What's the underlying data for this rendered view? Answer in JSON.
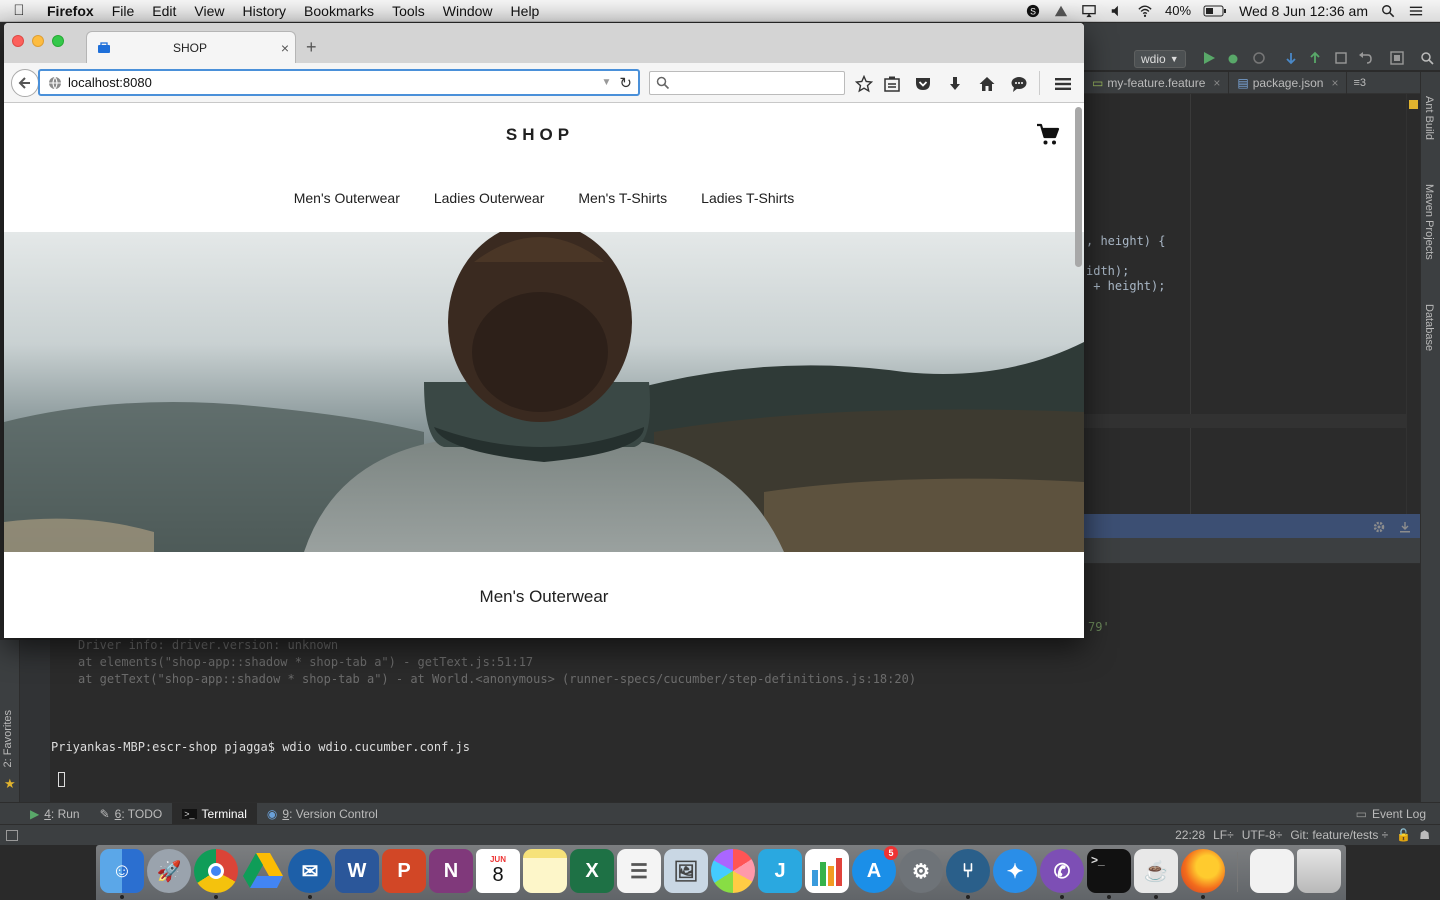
{
  "menubar": {
    "app": "Firefox",
    "items": [
      "File",
      "Edit",
      "View",
      "History",
      "Bookmarks",
      "Tools",
      "Window",
      "Help"
    ],
    "battery": "40%",
    "clock": "Wed 8 Jun  12:36 am"
  },
  "browser": {
    "tab_title": "SHOP",
    "url": "localhost:8080",
    "search_placeholder": ""
  },
  "page": {
    "brand": "SHOP",
    "nav": [
      "Men's Outerwear",
      "Ladies Outerwear",
      "Men's T-Shirts",
      "Ladies T-Shirts"
    ],
    "section_title": "Men's Outerwear"
  },
  "ide": {
    "run_config": "wdio",
    "tabs": [
      "my-feature.feature",
      "package.json"
    ],
    "tab_overflow": "≡3",
    "code_lines": [
      ", height) {",
      "idth);",
      " + height);"
    ],
    "code_right_fragment": "79'",
    "right_tool_windows": [
      "Ant Build",
      "Maven Projects",
      "Database"
    ],
    "left_tool_window": "2: Favorites",
    "terminal_lines": [
      "Driver info: driver.version: unknown",
      "at elements(\"shop-app::shadow * shop-tab a\") - getText.js:51:17",
      "at getText(\"shop-app::shadow * shop-tab a\") - at World.<anonymous> (runner-specs/cucumber/step-definitions.js:18:20)"
    ],
    "prompt": "Priyankas-MBP:escr-shop pjagga$ wdio wdio.cucumber.conf.js",
    "bottom_tabs": [
      {
        "num": "4",
        "label": ": Run"
      },
      {
        "num": "6",
        "label": ": TODO"
      },
      {
        "num": "",
        "label": "Terminal"
      },
      {
        "num": "9",
        "label": ": Version Control"
      }
    ],
    "event_log": "Event Log",
    "status_position": "22:28",
    "status_lf": "LF÷",
    "status_encoding": "UTF-8÷",
    "status_git": "Git: feature/tests ÷"
  },
  "dock": {
    "calendar_month": "JUN",
    "calendar_day": "8",
    "appstore_badge": "5",
    "app_letters": {
      "word": "W",
      "powerpoint": "P",
      "onenote": "N",
      "excel": "X"
    }
  }
}
